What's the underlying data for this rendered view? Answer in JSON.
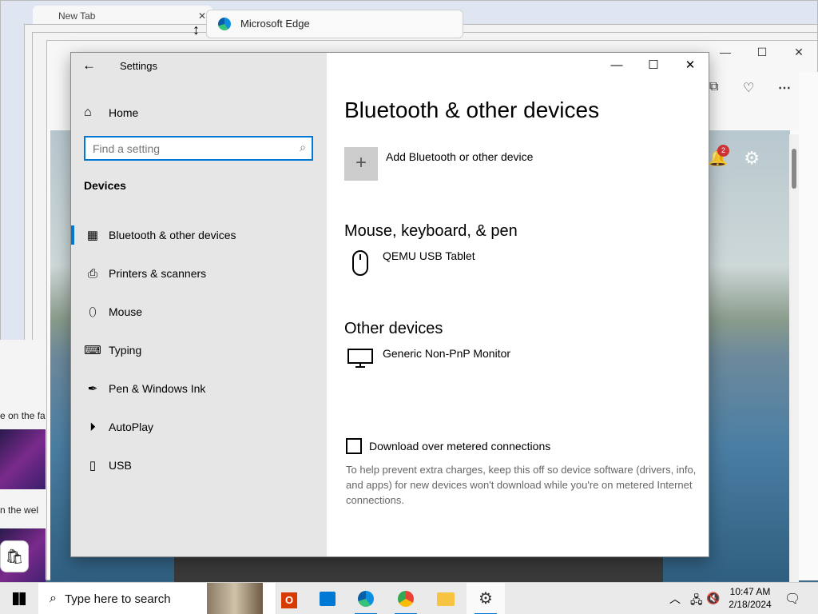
{
  "background": {
    "new_tab_label": "New Tab",
    "edge_window_label": "Microsoft Edge",
    "notification_count": "2",
    "left_texts": [
      "e on the fa",
      "n the wel"
    ]
  },
  "settings": {
    "window_title": "Settings",
    "home_label": "Home",
    "search_placeholder": "Find a setting",
    "section_heading": "Devices",
    "nav_items": [
      {
        "label": "Bluetooth & other devices",
        "icon": "bluetooth-devices-icon",
        "active": true
      },
      {
        "label": "Printers & scanners",
        "icon": "printer-icon",
        "active": false
      },
      {
        "label": "Mouse",
        "icon": "mouse-icon",
        "active": false
      },
      {
        "label": "Typing",
        "icon": "keyboard-icon",
        "active": false
      },
      {
        "label": "Pen & Windows Ink",
        "icon": "pen-icon",
        "active": false
      },
      {
        "label": "AutoPlay",
        "icon": "autoplay-icon",
        "active": false
      },
      {
        "label": "USB",
        "icon": "usb-icon",
        "active": false
      }
    ],
    "page_title": "Bluetooth & other devices",
    "add_device_label": "Add Bluetooth or other device",
    "mouse_section_heading": "Mouse, keyboard, & pen",
    "mouse_devices": [
      "QEMU USB Tablet"
    ],
    "other_section_heading": "Other devices",
    "other_devices": [
      "Generic Non-PnP Monitor"
    ],
    "metered_checkbox_label": "Download over metered connections",
    "metered_checked": false,
    "metered_help": "To help prevent extra charges, keep this off so device software (drivers, info, and apps) for new devices won't download while you're on metered Internet connections."
  },
  "taskbar": {
    "search_placeholder": "Type here to search",
    "time": "10:47 AM",
    "date": "2/18/2024"
  },
  "colors": {
    "accent": "#0078d4",
    "sidebar_bg": "#e6e6e6",
    "taskbar_bg": "#eaeaea"
  }
}
